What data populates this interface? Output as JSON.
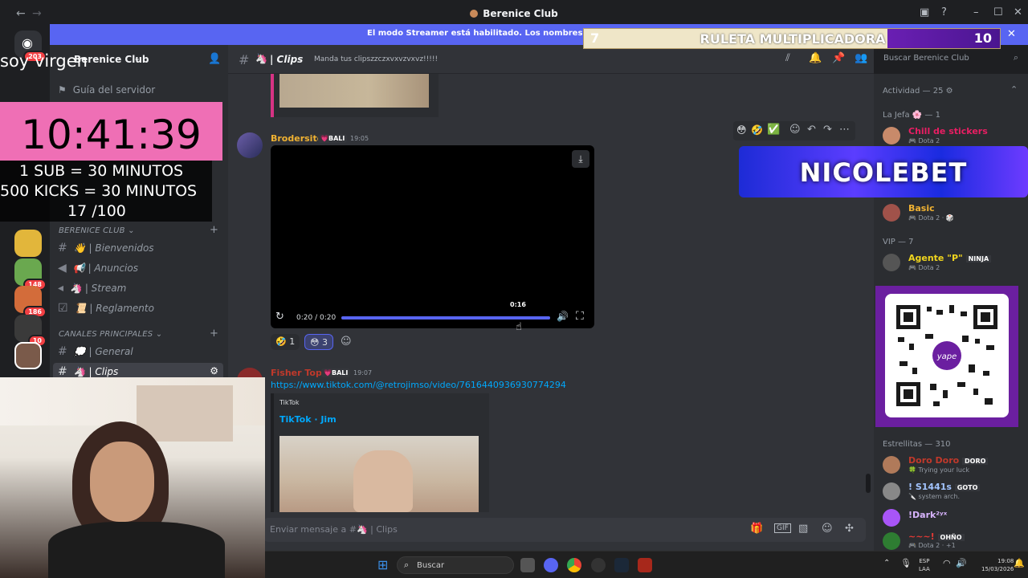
{
  "window": {
    "title": "Berenice Club",
    "back": "←",
    "forward": "→"
  },
  "banner": {
    "text": "El modo Streamer está habilitado. Los nombres de usuario se"
  },
  "rail": {
    "badges": [
      "203",
      "148",
      "186",
      "10"
    ]
  },
  "server": {
    "name": "Berenice Club",
    "guide": "Guía del servidor",
    "categories": [
      {
        "label": "BERENICE CLUB ⌄"
      },
      {
        "label": "CANALES PRINCIPALES ⌄"
      }
    ],
    "channels_a": [
      {
        "icon": "👋",
        "label": "| Bienvenidos"
      },
      {
        "icon": "📢",
        "label": "| Anuncios"
      },
      {
        "icon": "🦄",
        "label": "| Stream"
      },
      {
        "icon": "📜",
        "label": "| Reglamento"
      }
    ],
    "channels_b": [
      {
        "icon": "💭",
        "label": "| General"
      },
      {
        "icon": "🦄",
        "label": "| Clips"
      }
    ]
  },
  "chat": {
    "channel_name": "| Clips",
    "topic": "Manda tus clipszzczxvxvzvxvz!!!!!",
    "search_placeholder": "Buscar Berenice Club",
    "messages": [
      {
        "author": "Brodersito",
        "tag": "BALI",
        "time": "19:05",
        "video_time": "0:20 / 0:20",
        "hover_time": "0:16",
        "reactions": [
          {
            "emoji": "🤣",
            "count": "1"
          },
          {
            "emoji": "😳",
            "count": "3"
          }
        ]
      },
      {
        "author": "Fisher Topo",
        "tag": "BALI",
        "time": "19:07",
        "link": "https://www.tiktok.com/@retrojimso/video/7616440936930774294",
        "embed_provider": "TikTok",
        "embed_title": "TikTok · Jim"
      }
    ],
    "input_placeholder": "Enviar mensaje a #🦄 | Clips"
  },
  "members": {
    "activity_header": "Actividad — 25 ⚙",
    "groups": [
      {
        "header": "La Jefa 🌸 — 1"
      },
      {
        "header": "VIP — 7"
      },
      {
        "header": "Estrellitas — 310"
      }
    ],
    "rows": [
      {
        "name": "Chill de stickers",
        "status": "Dota 2",
        "color": "#e91e63"
      },
      {
        "name": "Basic",
        "status": "Dota 2 · 🎲",
        "color": "#f0b232"
      },
      {
        "name": "Agente \"P\"",
        "tag": "NINJA",
        "status": "Dota 2",
        "color": "#f0d51e"
      },
      {
        "name": "Doro Doro",
        "tag": "DORO",
        "status": "Trying your luck",
        "color": "#c0392b"
      },
      {
        "name": "! S1441s",
        "tag": "GOTO",
        "status": "system arch.",
        "color": "#a2c4ff"
      },
      {
        "name": "!Dark²ʸˣ",
        "tag": "",
        "status": "",
        "color": "#d8b4fe"
      },
      {
        "name": "~~~!",
        "tag": "OHÑO",
        "status": "Dota 2 · +1",
        "color": "#e53935"
      }
    ]
  },
  "overlays": {
    "ruleta": {
      "left": "7",
      "title": "RULETA MULTIPLICADORA",
      "right": "10"
    },
    "soy": "soy virgen",
    "timer": "10:41:39",
    "lines": [
      "1 SUB      = 30 MINUTOS",
      "500 KICKS = 30 MINUTOS",
      "17 /100"
    ],
    "nicole": "NICOLEBET"
  },
  "taskbar": {
    "search": "Buscar",
    "lang": "ESP\nLAA",
    "lang1": "ESP",
    "lang2": "LAA",
    "time": "19:08",
    "date": "15/03/2026"
  },
  "colors": {
    "accent": "#5865f2",
    "pink": "#ef6fb5",
    "link": "#00a8fc",
    "author": "#f0b232"
  }
}
